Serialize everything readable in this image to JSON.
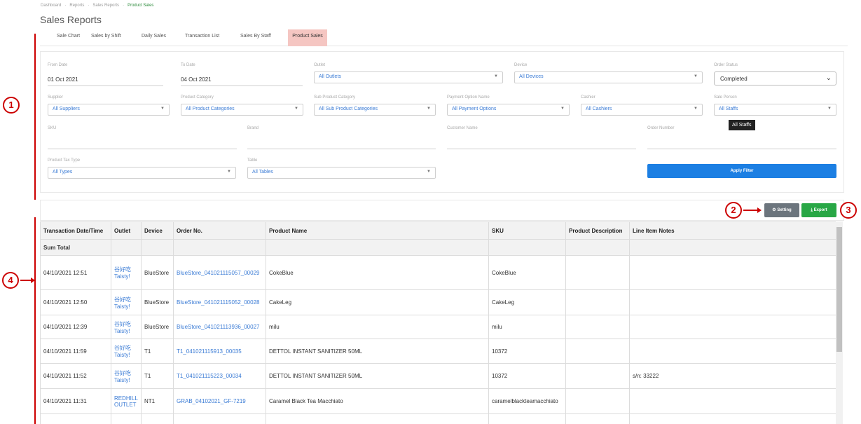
{
  "breadcrumb": [
    "Dashboard",
    "Reports",
    "Sales Reports",
    "Product Sales"
  ],
  "breadcrumb_sep": "·",
  "page_title": "Sales Reports",
  "tabs": [
    "Sale Chart",
    "Sales by Shift",
    "Daily Sales",
    "Transaction List",
    "Sales By Staff",
    "Product Sales"
  ],
  "active_tab": "Product Sales",
  "filters": {
    "from_date": {
      "label": "From Date",
      "value": "01 Oct 2021"
    },
    "to_date": {
      "label": "To Date",
      "value": "04 Oct 2021"
    },
    "outlet": {
      "label": "Outlet",
      "value": "All Outlets"
    },
    "device": {
      "label": "Device",
      "value": "All Devices"
    },
    "order_status": {
      "label": "Order Status",
      "value": "Completed"
    },
    "supplier": {
      "label": "Supplier",
      "value": "All Suppliers"
    },
    "product_category": {
      "label": "Product Category",
      "value": "All Product Categories"
    },
    "sub_product_category": {
      "label": "Sub Product Category",
      "value": "All Sub Product Categories"
    },
    "payment_option": {
      "label": "Payment Option Name",
      "value": "All Payment Options"
    },
    "cashier": {
      "label": "Cashier",
      "value": "All Cashiers"
    },
    "sale_person": {
      "label": "Sale Person",
      "value": "All Staffs"
    },
    "sku": {
      "label": "SKU",
      "value": ""
    },
    "brand": {
      "label": "Brand",
      "value": ""
    },
    "customer_name": {
      "label": "Customer Name",
      "value": ""
    },
    "order_number": {
      "label": "Order Number",
      "value": ""
    },
    "product_tax_type": {
      "label": "Product Tax Type",
      "value": "All Types"
    },
    "table": {
      "label": "Table",
      "value": "All Tables"
    }
  },
  "tooltip": "All Staffs",
  "apply_button": "Apply Filter",
  "setting_button": "⚙ Setting",
  "export_button": "⤓ Export",
  "table": {
    "columns": [
      "Transaction Date/Time",
      "Outlet",
      "Device",
      "Order No.",
      "Product Name",
      "SKU",
      "Product Description",
      "Line Item Notes"
    ],
    "sum_label": "Sum Total",
    "rows": [
      {
        "datetime": "04/10/2021 12:51",
        "outlet": "谷好吃 Taisty!",
        "device": "BlueStore",
        "order": "BlueStore_041021115057_00029",
        "product": "CokeBlue",
        "sku": "CokeBlue",
        "desc": "",
        "notes": ""
      },
      {
        "datetime": "04/10/2021 12:50",
        "outlet": "谷好吃 Taisty!",
        "device": "BlueStore",
        "order": "BlueStore_041021115052_00028",
        "product": "CakeLeg",
        "sku": "CakeLeg",
        "desc": "",
        "notes": ""
      },
      {
        "datetime": "04/10/2021 12:39",
        "outlet": "谷好吃 Taisty!",
        "device": "BlueStore",
        "order": "BlueStore_041021113936_00027",
        "product": "milu",
        "sku": "milu",
        "desc": "",
        "notes": ""
      },
      {
        "datetime": "04/10/2021 11:59",
        "outlet": "谷好吃 Taisty!",
        "device": "T1",
        "order": "T1_041021115913_00035",
        "product": "DETTOL INSTANT SANITIZER 50ML",
        "sku": "10372",
        "desc": "",
        "notes": ""
      },
      {
        "datetime": "04/10/2021 11:52",
        "outlet": "谷好吃 Taisty!",
        "device": "T1",
        "order": "T1_041021115223_00034",
        "product": "DETTOL INSTANT SANITIZER 50ML",
        "sku": "10372",
        "desc": "",
        "notes": "s/n: 33222"
      },
      {
        "datetime": "04/10/2021 11:31",
        "outlet": "REDHILL OUTLET",
        "device": "NT1",
        "order": "GRAB_04102021_GF-7219",
        "product": "Caramel Black Tea Macchiato",
        "sku": "caramelblackteamacchiato",
        "desc": "",
        "notes": ""
      }
    ]
  },
  "annotations": [
    "1",
    "2",
    "3",
    "4"
  ],
  "colors": {
    "accent": "#1c7fe3",
    "active_tab": "#f5c6c2",
    "export": "#28a745",
    "setting": "#6c757d",
    "annotation": "#cc0000"
  }
}
